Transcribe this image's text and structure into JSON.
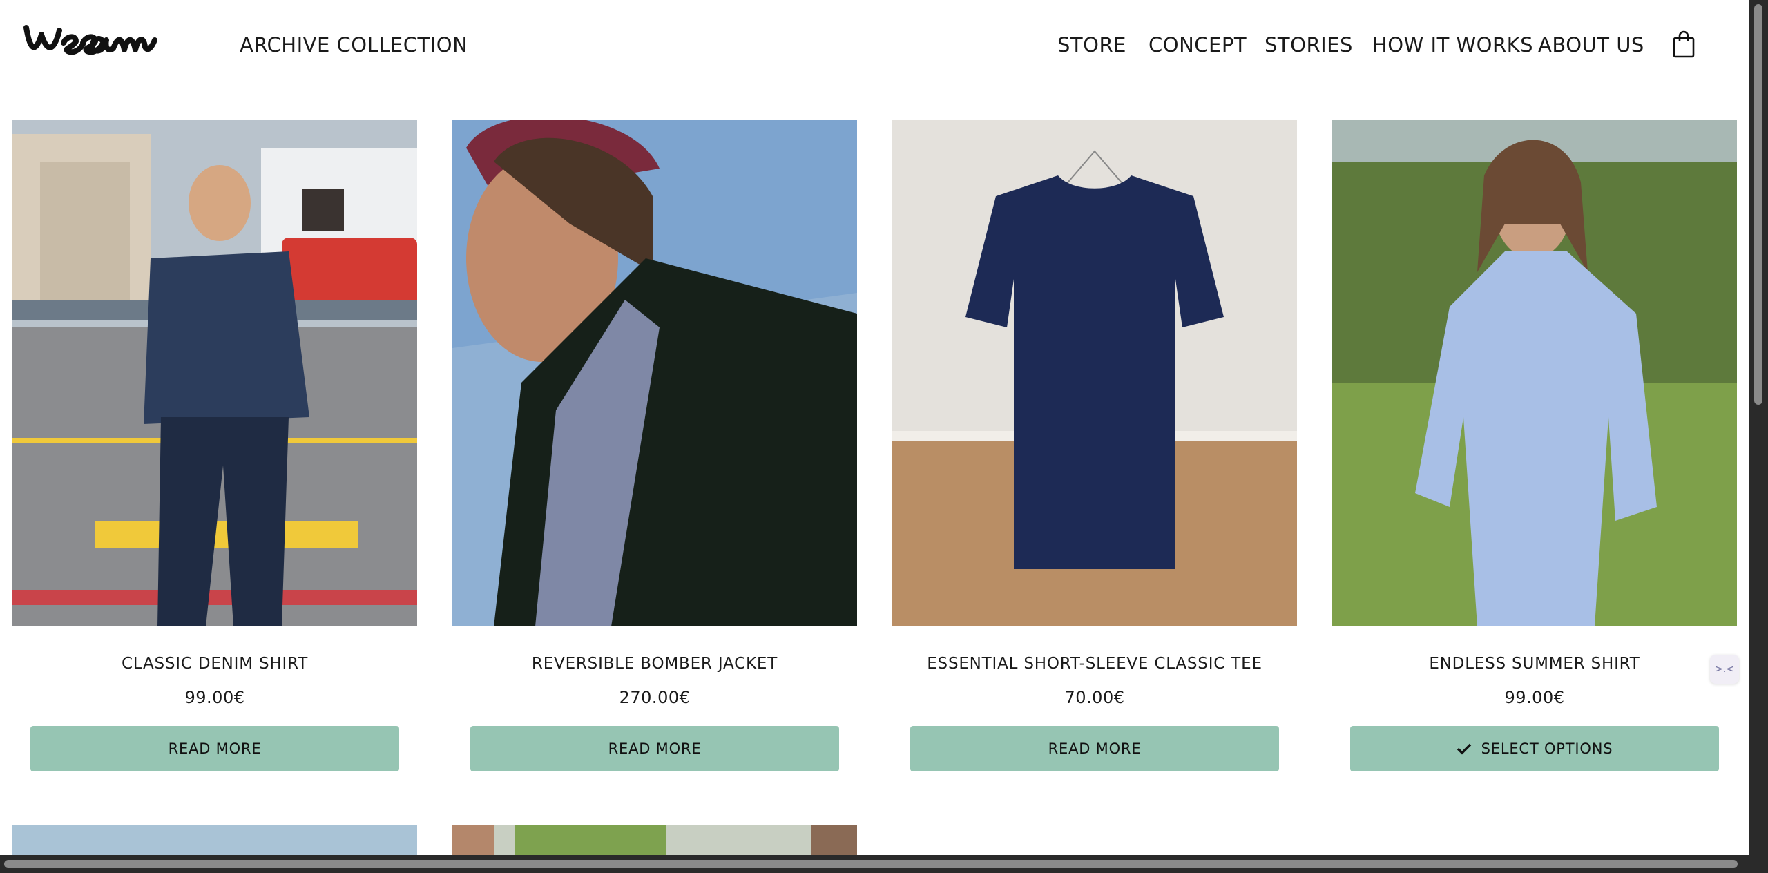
{
  "brand": {
    "logo_text": "weeam",
    "collection_label": "ARCHIVE COLLECTION"
  },
  "nav": {
    "items": [
      "STORE",
      "CONCEPT",
      "STORIES",
      "HOW IT WORKS",
      "ABOUT US"
    ],
    "cart_icon": "shopping-bag-icon"
  },
  "products": [
    {
      "name": "CLASSIC DENIM SHIRT",
      "price": "99.00€",
      "button": "READ MORE"
    },
    {
      "name": "REVERSIBLE BOMBER JACKET",
      "price": "270.00€",
      "button": "READ MORE"
    },
    {
      "name": "ESSENTIAL SHORT-SLEEVE CLASSIC TEE",
      "price": "70.00€",
      "button": "READ MORE"
    },
    {
      "name": "ENDLESS SUMMER SHIRT",
      "price": "99.00€",
      "button": "SELECT OPTIONS",
      "button_icon": "check-icon"
    }
  ],
  "colors": {
    "button_bg": "#96c5b3",
    "text": "#1a1a1a"
  }
}
